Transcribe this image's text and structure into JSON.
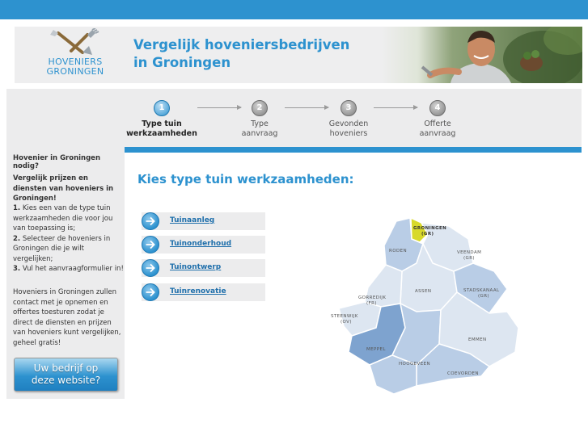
{
  "header": {
    "logo_line1": "HOVENIERS",
    "logo_line2": "GRONINGEN",
    "title_line1": "Vergelijk hoveniersbedrijven",
    "title_line2": "in Groningen"
  },
  "steps": [
    {
      "number": "1",
      "line1": "Type tuin",
      "line2": "werkzaamheden",
      "active": true
    },
    {
      "number": "2",
      "line1": "Type",
      "line2": "aanvraag",
      "active": false
    },
    {
      "number": "3",
      "line1": "Gevonden",
      "line2": "hoveniers",
      "active": false
    },
    {
      "number": "4",
      "line1": "Offerte",
      "line2": "aanvraag",
      "active": false
    }
  ],
  "sidebar": {
    "heading": "Hovenier in Groningen nodig?",
    "subheading": "Vergelijk prijzen en diensten van hoveniers in Groningen!",
    "step1_num": "1.",
    "step1_text": " Kies een van de type tuin werkzaamheden die voor jou van toepassing is;",
    "step2_num": "2.",
    "step2_text": " Selecteer de hoveniers in Groningen die je wilt vergelijken;",
    "step3_num": "3.",
    "step3_text": " Vul het aanvraagformulier in!",
    "closing": "Hoveniers in Groningen zullen contact met je opnemen en offertes toesturen zodat je direct de diensten en prijzen van hoveniers kunt vergelijken, geheel gratis!",
    "cta_line1": "Uw bedrijf op",
    "cta_line2": "deze website?"
  },
  "main": {
    "heading": "Kies type tuin werkzaamheden:",
    "options": [
      "Tuinaanleg",
      "Tuinonderhoud",
      "Tuinontwerp",
      "Tuinrenovatie"
    ]
  },
  "map": {
    "labels": {
      "groningen": "GRONINGEN",
      "groningen_sub": "(GR)",
      "roden": "RODEN",
      "veendam": "VEENDAM",
      "veendam_sub": "(GR)",
      "assen": "ASSEN",
      "gorredijk": "GORREDIJK",
      "gorredijk_sub": "(FR)",
      "stadskanaal": "STADSKANAAL",
      "stadskanaal_sub": "(GR)",
      "steenwijk": "STEENWIJK",
      "steenwijk_sub": "(OV)",
      "meppel": "MEPPEL",
      "emmen": "EMMEN",
      "hoogeveen": "HOOGEVEEN",
      "coevorden": "COEVORDEN"
    },
    "colors": {
      "highlight": "#d8d92a",
      "light": "#dde6f1",
      "mid": "#b9cde6",
      "dark": "#7ea3cf"
    }
  },
  "colors": {
    "brand_blue": "#2d92cf",
    "panel_grey": "#ececed"
  }
}
